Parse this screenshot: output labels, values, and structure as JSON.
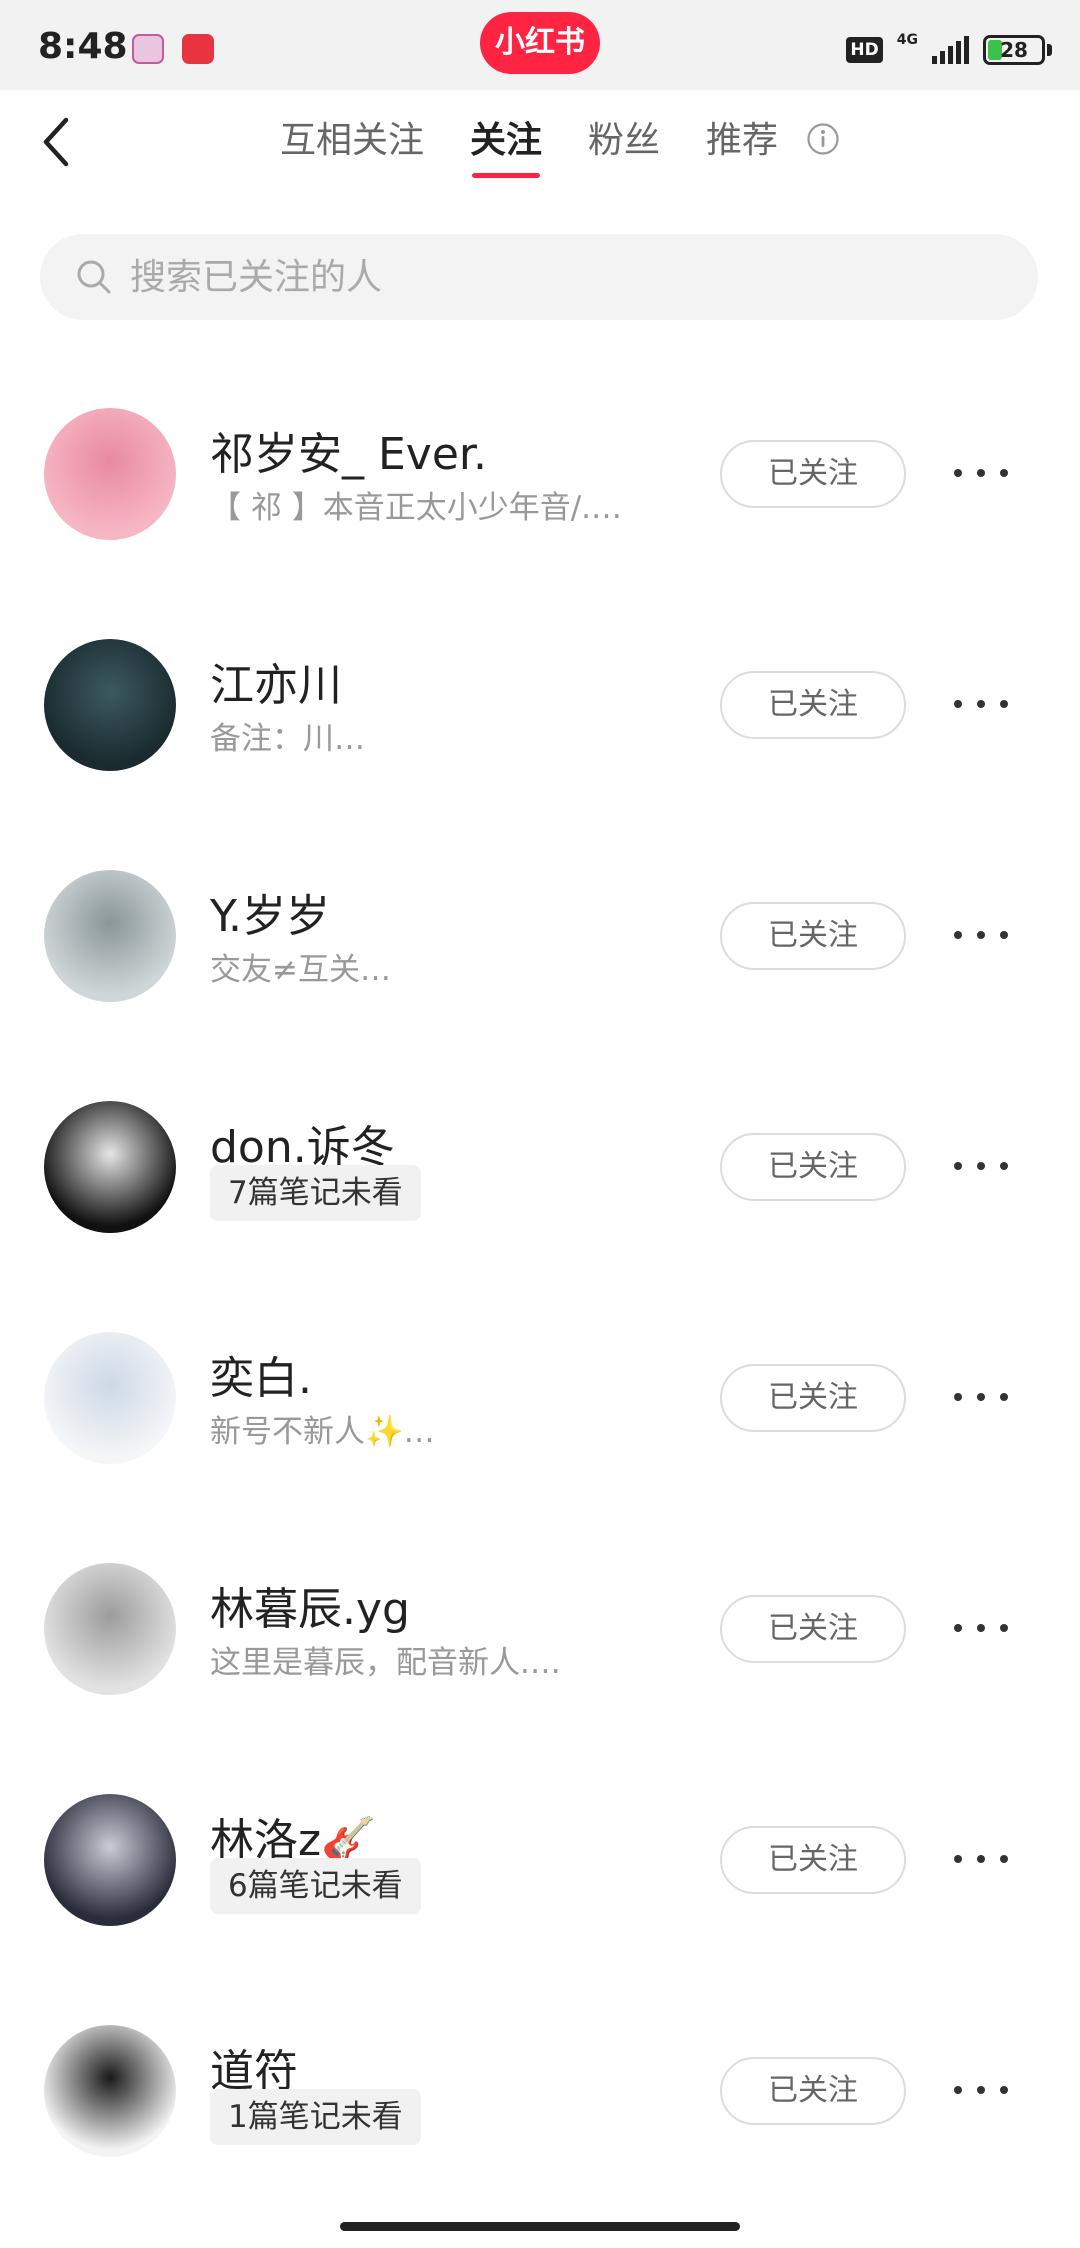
{
  "status": {
    "time": "8:48",
    "hd": "HD",
    "network": "4G",
    "battery": "28",
    "brand": "小红书"
  },
  "nav": {
    "tabs": [
      "互相关注",
      "关注",
      "粉丝",
      "推荐"
    ],
    "active_tab": "关注"
  },
  "search": {
    "placeholder": "搜索已关注的人"
  },
  "follow_label": "已关注",
  "users": [
    {
      "name": "祁岁安_ Ever.",
      "subtitle": "【 祁 】本音正太小少年音/.…",
      "badge": "",
      "avatar_colors": [
        "#f7b6c4",
        "#e88aa0"
      ]
    },
    {
      "name": "江亦川",
      "subtitle": "备注：川…",
      "badge": "",
      "avatar_colors": [
        "#1a2a2e",
        "#3b5a60"
      ]
    },
    {
      "name": "Y.岁岁",
      "subtitle": "交友≠互关…",
      "badge": "",
      "avatar_colors": [
        "#cfd6d8",
        "#8a9698"
      ]
    },
    {
      "name": "don.诉冬",
      "subtitle": "",
      "badge": "7篇笔记未看",
      "avatar_colors": [
        "#111111",
        "#e6e6e6"
      ]
    },
    {
      "name": "奕白.",
      "subtitle": "新号不新人✨…",
      "badge": "",
      "avatar_colors": [
        "#f4f6f8",
        "#cdd8e6"
      ]
    },
    {
      "name": "林暮辰.yg",
      "subtitle": "这里是暮辰，配音新人.…",
      "badge": "",
      "avatar_colors": [
        "#e2e2e2",
        "#9c9c9c"
      ]
    },
    {
      "name": "林洛z🎸",
      "subtitle": "",
      "badge": "6篇笔记未看",
      "avatar_colors": [
        "#2a2c3a",
        "#c9cbd6"
      ]
    },
    {
      "name": "道符",
      "subtitle": "",
      "badge": "1篇笔记未看",
      "avatar_colors": [
        "#f3f3f3",
        "#1a1a1a"
      ]
    }
  ]
}
